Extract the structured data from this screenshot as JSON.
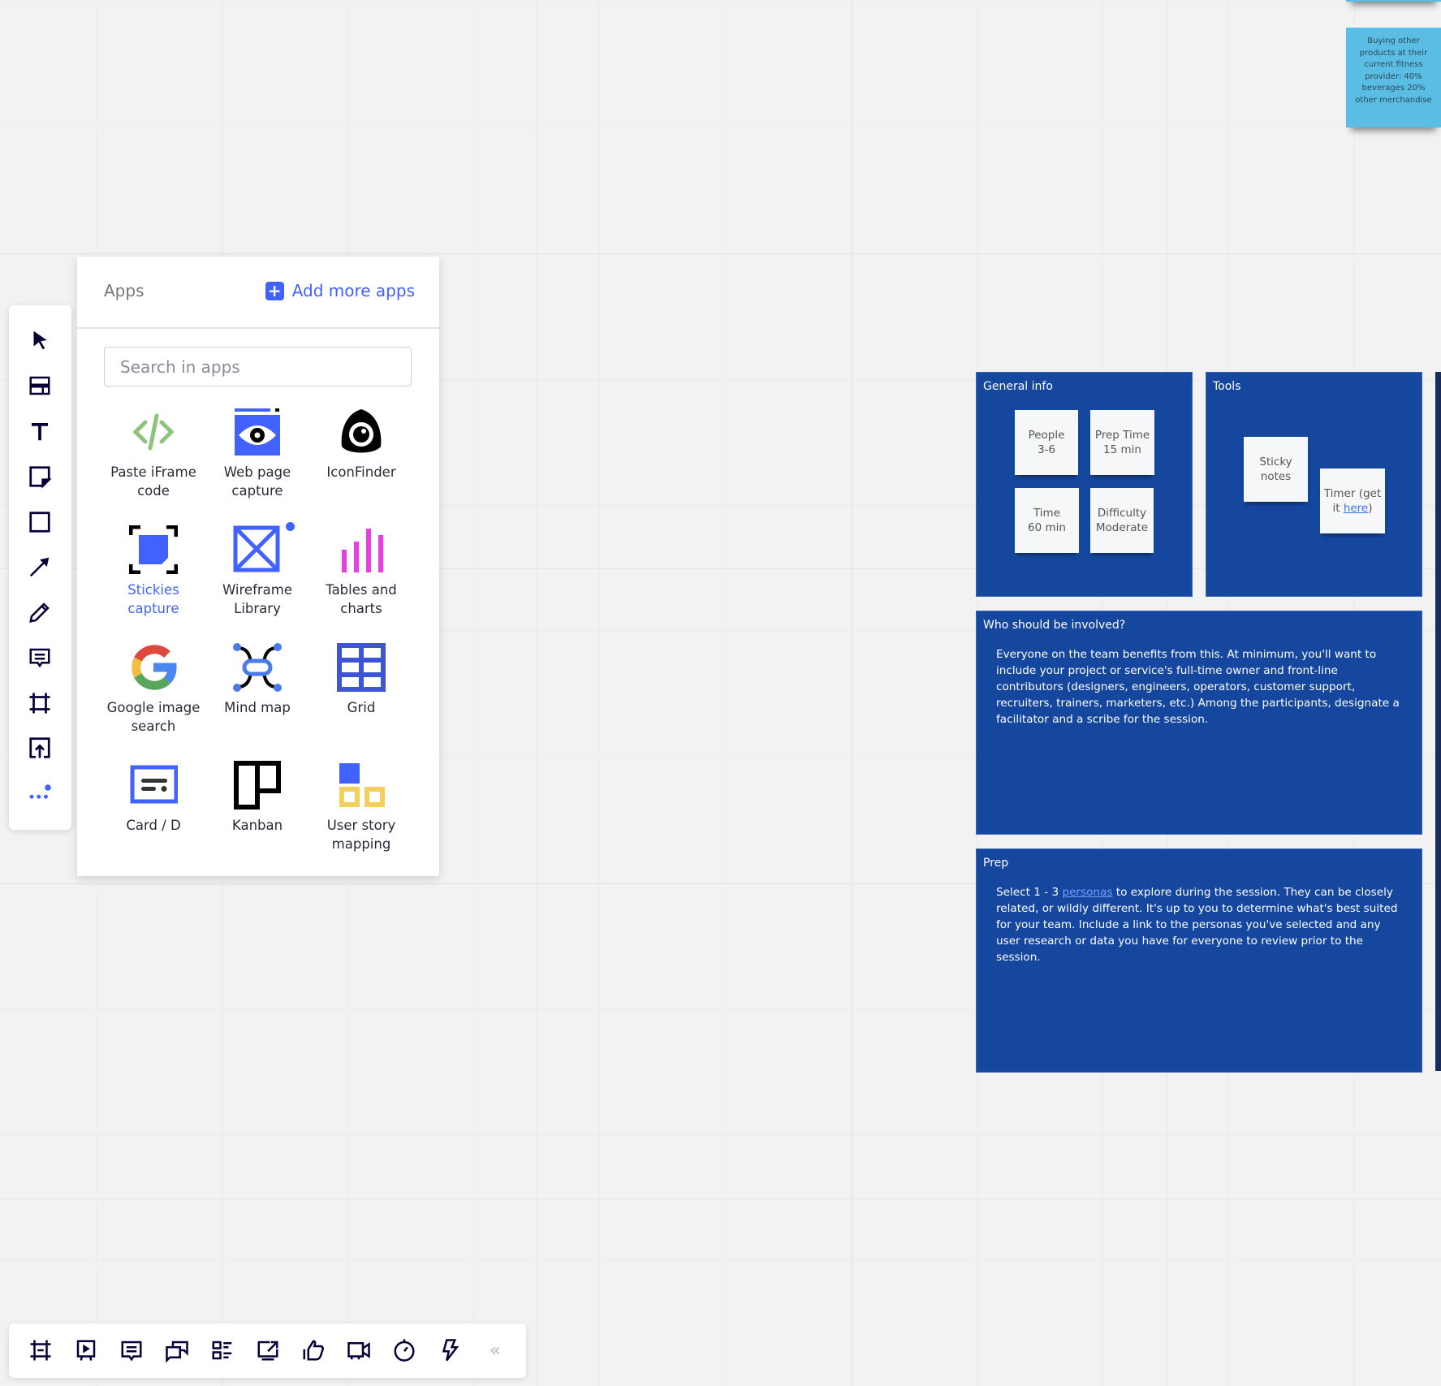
{
  "canvas": {
    "sticky_top_right": {
      "text": "Buying other products at their current fitness provider: 40% beverages 20% other merchandise"
    },
    "frames": [
      {
        "title": "General info",
        "notes": [
          "People\n3-6",
          "Prep Time\n15 min",
          "Time\n60 min",
          "Difficulty\nModerate"
        ]
      },
      {
        "title": "Tools",
        "notes": [
          "Sticky\nnotes"
        ],
        "timer_note": {
          "prefix": "Timer (get\nit ",
          "link": "here",
          "suffix": ")"
        }
      },
      {
        "title": "Who should be involved?",
        "body": "Everyone on the team benefits from this. At minimum, you'll want to include your project or service's full-time owner and front-line contributors (designers, engineers, operators, customer support, recruiters, trainers, marketers, etc.) Among the participants, designate a facilitator and a scribe for the session."
      },
      {
        "title": "Prep",
        "body_prefix": "Select 1 - 3 ",
        "body_link": "personas",
        "body_suffix": " to explore during the session. They can be closely related, or wildly different. It's up to you to determine what's best suited for your team. Include a link to the personas you've selected and any user research or data you have for everyone to review prior to the session."
      }
    ]
  },
  "left_toolbar": {
    "tools": [
      "select-cursor-icon",
      "templates-icon",
      "text-icon",
      "sticky-note-icon",
      "shape-icon",
      "arrow-line-icon",
      "pen-icon",
      "comment-icon",
      "frame-icon",
      "upload-icon",
      "more-apps-icon"
    ]
  },
  "apps_panel": {
    "title": "Apps",
    "add_more_label": "Add more apps",
    "search_placeholder": "Search in apps",
    "apps": [
      {
        "label": "Paste iFrame\ncode",
        "icon": "code-icon"
      },
      {
        "label": "Web page\ncapture",
        "icon": "eye-capture-icon"
      },
      {
        "label": "IconFinder",
        "icon": "iconfinder-icon"
      },
      {
        "label": "Stickies capture",
        "icon": "stickies-capture-icon",
        "active": true
      },
      {
        "label": "Wireframe\nLibrary",
        "icon": "wireframe-icon",
        "badge": true
      },
      {
        "label": "Tables and\ncharts",
        "icon": "bar-chart-icon"
      },
      {
        "label": "Google image\nsearch",
        "icon": "google-icon"
      },
      {
        "label": "Mind map",
        "icon": "mind-map-icon"
      },
      {
        "label": "Grid",
        "icon": "grid-icon"
      },
      {
        "label": "Card / D",
        "icon": "card-icon"
      },
      {
        "label": "Kanban",
        "icon": "kanban-icon"
      },
      {
        "label": "User story\nmapping",
        "icon": "user-story-map-icon"
      }
    ]
  },
  "bottom_toolbar": {
    "tools": [
      "frames-icon",
      "presentation-icon",
      "comments-icon",
      "chat-icon",
      "card-list-icon",
      "share-screen-icon",
      "voting-icon",
      "video-call-icon",
      "timer-icon",
      "lightning-icon",
      "collapse-icon"
    ]
  },
  "colors": {
    "frame": "#16479f",
    "accent": "#4262ff",
    "sticky_cyan": "#5bbde4",
    "icon": "#050038"
  }
}
